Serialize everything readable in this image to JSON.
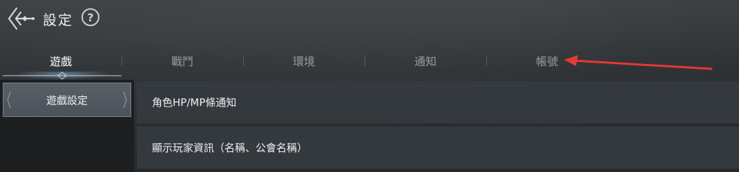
{
  "header": {
    "title": "設定",
    "help_label": "?"
  },
  "tabs": [
    {
      "label": "遊戲",
      "active": true
    },
    {
      "label": "戰鬥",
      "active": false
    },
    {
      "label": "環境",
      "active": false
    },
    {
      "label": "通知",
      "active": false
    },
    {
      "label": "帳號",
      "active": false
    }
  ],
  "sidebar": {
    "items": [
      {
        "label": "遊戲設定",
        "selected": true
      }
    ]
  },
  "content": {
    "rows": [
      {
        "label": "角色HP/MP條通知"
      },
      {
        "label": "顯示玩家資訊（名稱、公會名稱）"
      }
    ]
  },
  "colors": {
    "accent_arrow": "#e53935",
    "active_tab_glow": "#9fd3ff"
  },
  "icons": {
    "back": "back-arrow-icon",
    "help": "help-icon"
  }
}
